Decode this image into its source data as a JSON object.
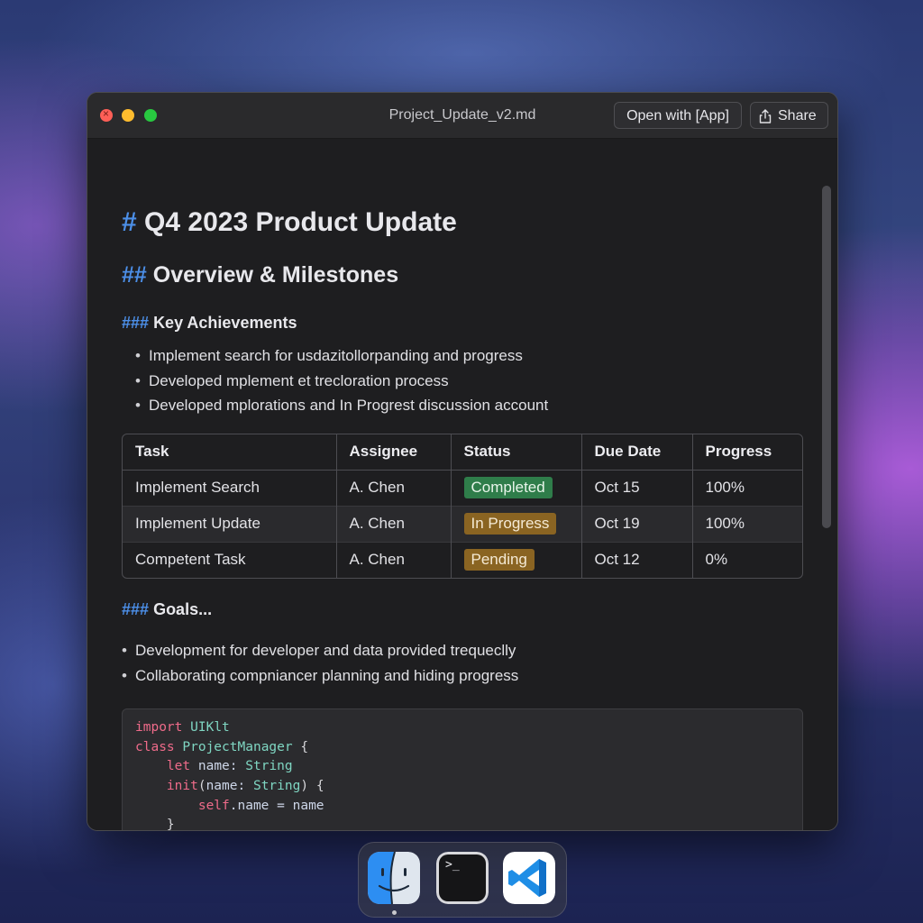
{
  "window": {
    "title": "Project_Update_v2.md",
    "open_with_label": "Open with [App]",
    "share_label": "Share"
  },
  "doc": {
    "h1_marker": "#",
    "h1_text": "Q4 2023 Product Update",
    "h2_marker": "##",
    "h2_text": "Overview & Milestones",
    "h3_marker": "###",
    "h3_text": "Key Achievements",
    "achievements": [
      "Implement search for usdazitollorpanding and progress",
      "Developed mplement et trecloration process",
      "Developed mplorations and In Progrest discussion account"
    ],
    "table": {
      "headers": [
        "Task",
        "Assignee",
        "Status",
        "Due Date",
        "Progress"
      ],
      "rows": [
        {
          "task": "Implement Search",
          "assignee": "A. Chen",
          "status": "Completed",
          "due": "Oct 15",
          "progress": "100%"
        },
        {
          "task": "Implement Update",
          "assignee": "A. Chen",
          "status": "In Progress",
          "due": "Oct 19",
          "progress": "100%"
        },
        {
          "task": "Competent Task",
          "assignee": "A. Chen",
          "status": "Pending",
          "due": "Oct 12",
          "progress": "0%"
        }
      ]
    },
    "goals_marker": "###",
    "goals_text": "Goals...",
    "goals": [
      "Development for developer and data provided trequeclly",
      "Collaborating compniancer planning and hiding progress"
    ],
    "code": {
      "l1_kw": "import",
      "l1_id": "UIKlt",
      "l2_kw": "class",
      "l2_ty": "ProjectManager",
      "l2_rest": "{",
      "l3_kw": "let",
      "l3_id": "name:",
      "l3_ty": "String",
      "l4_kw": "init",
      "l4_open": "(",
      "l4_id": "name:",
      "l4_ty": "String",
      "l4_rest": ") {",
      "l5_kw": "self",
      "l5_rest": ".name = name",
      "l6": "}",
      "l7": "}"
    }
  },
  "colors": {
    "heading_marker": "#4c8fe8",
    "badge_completed": "#2f7d4a",
    "badge_in_progress": "#8a6422",
    "badge_pending": "#8a6422",
    "code_keyword": "#ef6b8a",
    "code_type": "#7fd6c2"
  },
  "dock": {
    "apps": [
      "finder-icon",
      "terminal-icon",
      "vscode-icon"
    ],
    "terminal_prompt": ">_"
  }
}
